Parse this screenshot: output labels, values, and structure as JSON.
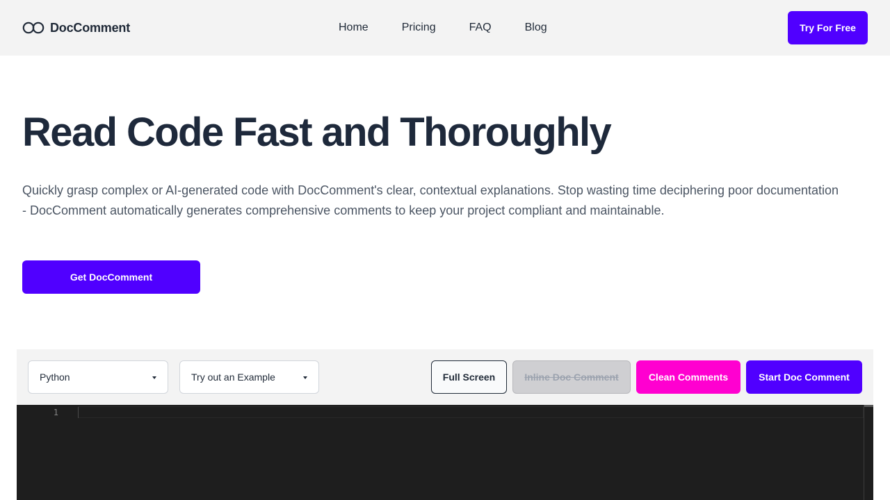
{
  "brand": {
    "name": "DocComment",
    "logo_icon": "infinity-rings-icon"
  },
  "nav": {
    "items": [
      "Home",
      "Pricing",
      "FAQ",
      "Blog"
    ]
  },
  "header": {
    "cta_label": "Try For Free"
  },
  "hero": {
    "title": "Read Code Fast and Thoroughly",
    "description": "Quickly grasp complex or AI-generated code with DocComment's clear, contextual explanations. Stop wasting time deciphering poor documentation - DocComment automatically generates comprehensive comments to keep your project compliant and maintainable.",
    "cta_label": "Get DocComment"
  },
  "editor": {
    "language_select": "Python",
    "example_select": "Try out an Example",
    "buttons": {
      "full_screen": "Full Screen",
      "inline_doc_comment": "Inline Doc Comment",
      "clean_comments": "Clean Comments",
      "start_doc_comment": "Start Doc Comment"
    },
    "line_numbers": [
      "1"
    ]
  },
  "colors": {
    "primary": "#5000ff",
    "magenta": "#ff00d0",
    "text_dark": "#1e293b",
    "editor_bg": "#1e1e1e"
  }
}
